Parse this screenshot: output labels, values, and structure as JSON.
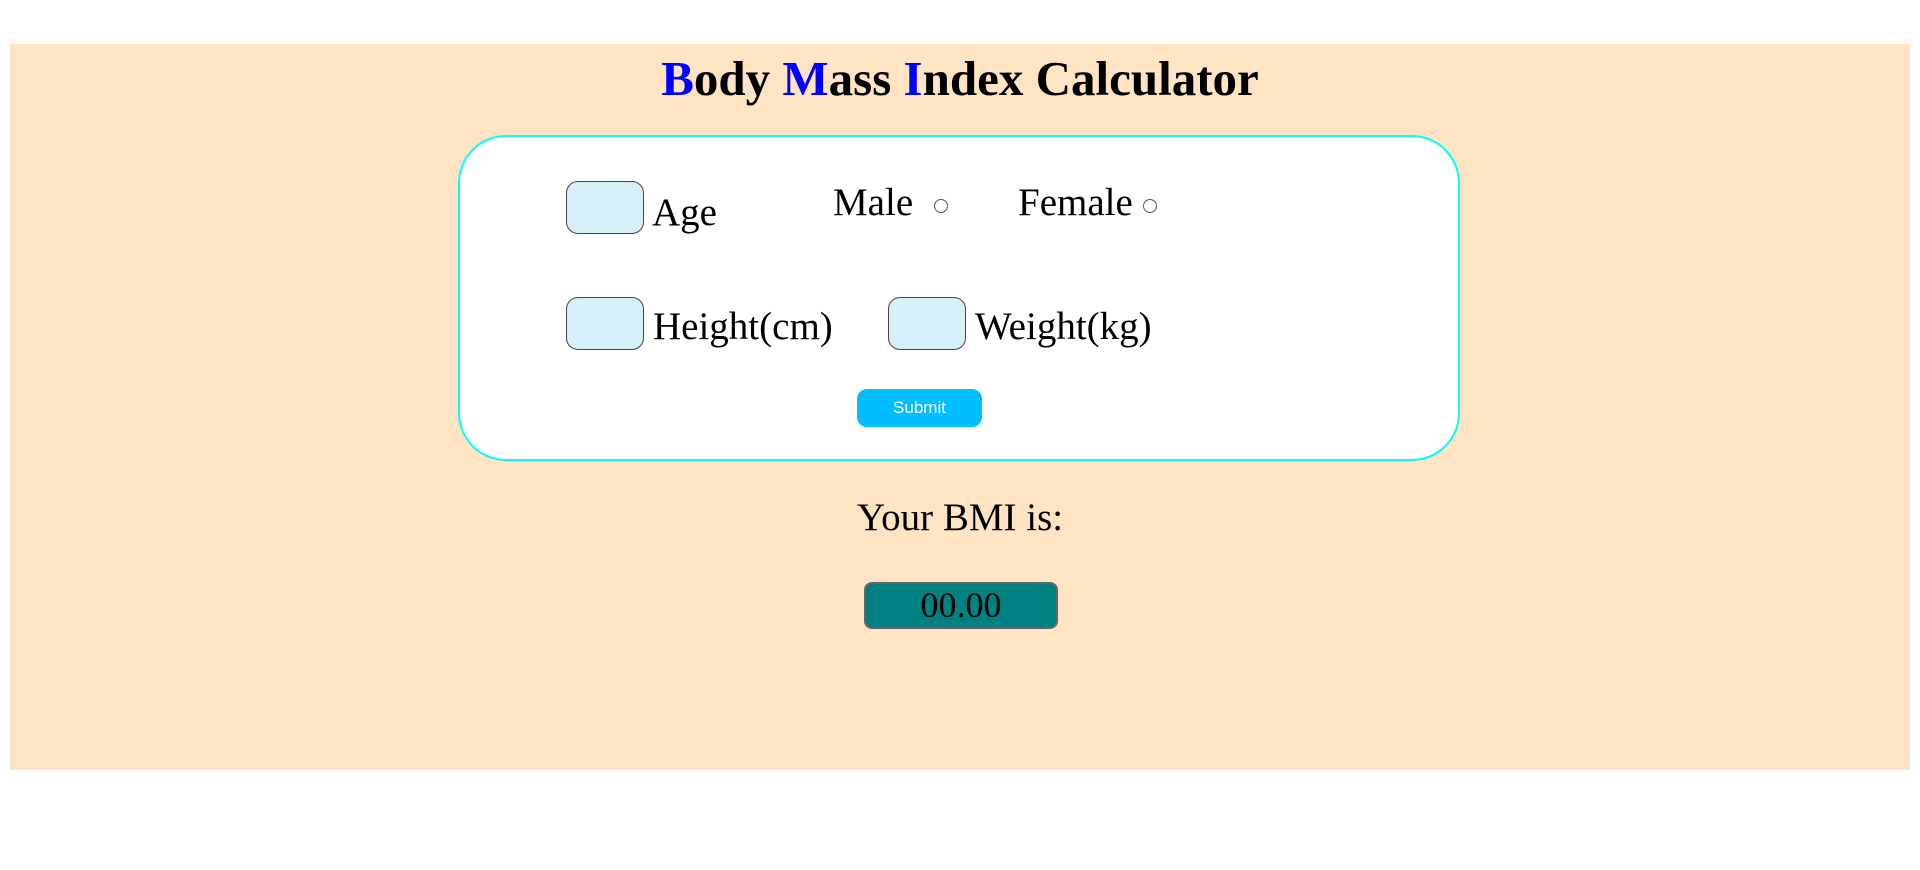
{
  "header": {
    "title_parts": [
      {
        "text": "B",
        "accent": true
      },
      {
        "text": "ody ",
        "accent": false
      },
      {
        "text": "M",
        "accent": true
      },
      {
        "text": "ass ",
        "accent": false
      },
      {
        "text": "I",
        "accent": true
      },
      {
        "text": "ndex Calculator",
        "accent": false
      }
    ]
  },
  "form": {
    "age": {
      "label": "Age",
      "value": ""
    },
    "gender": {
      "male_label": "Male",
      "female_label": "Female"
    },
    "height": {
      "label": "Height(cm)",
      "value": ""
    },
    "weight": {
      "label": "Weight(kg)",
      "value": ""
    },
    "submit_label": "Submit"
  },
  "result": {
    "label": "Your BMI is:",
    "value": "00.00"
  },
  "colors": {
    "page_background": "#ffe4c3",
    "title_accent": "#0000ff",
    "card_border": "#00ffff",
    "input_fill": "#d5f0f8",
    "submit_button": "#00bfff",
    "result_fill": "#008080"
  }
}
